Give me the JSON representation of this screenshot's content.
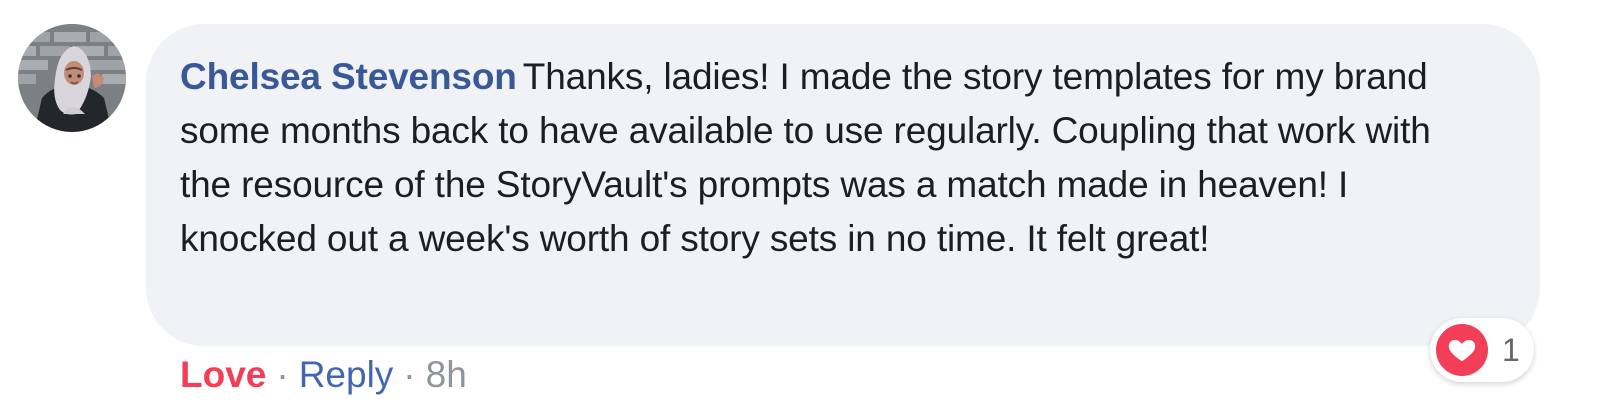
{
  "comment": {
    "author": "Chelsea Stevenson",
    "text": "Thanks, ladies! I made the story templates for my brand some months back to have available to use regularly. Coupling that work with the resource of the StoryVault's prompts was a match made in heaven! I knocked out a week's worth of story sets in no time. It felt great!"
  },
  "actions": {
    "love_label": "Love",
    "reply_label": "Reply",
    "separator": "·",
    "timestamp": "8h"
  },
  "reactions": {
    "icon": "heart-icon",
    "count": "1"
  },
  "colors": {
    "author": "#385898",
    "love": "#f33e58",
    "reply": "#4267b2",
    "bubble_bg": "#f0f2f5"
  }
}
